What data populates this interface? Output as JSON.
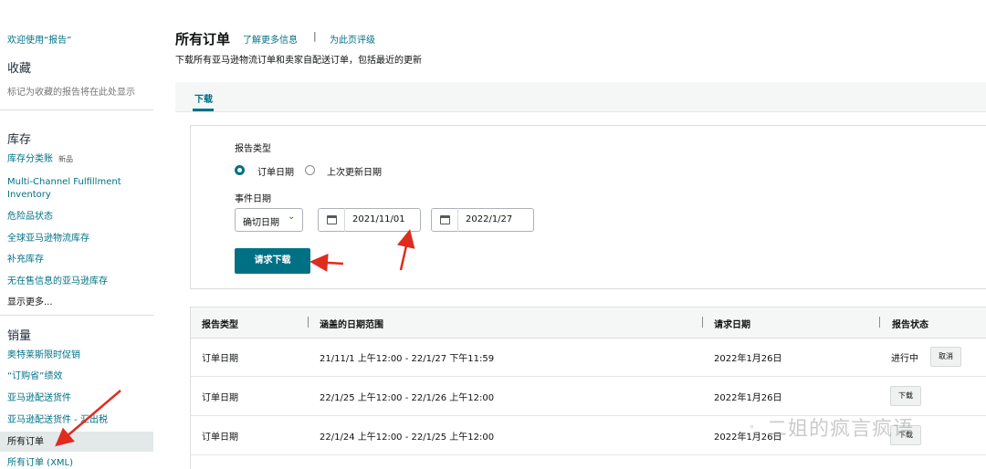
{
  "sidebar": {
    "welcome": "欢迎使用“报告”",
    "favorites_heading": "收藏",
    "favorites_note": "标记为收藏的报告将在此处显示",
    "inventory_heading": "库存",
    "inventory_items": [
      "库存分类账",
      "Multi-Channel Fulfillment Inventory",
      "危险品状态",
      "全球亚马逊物流库存",
      "补充库存",
      "无在售信息的亚马逊库存",
      "显示更多..."
    ],
    "new_badge": "新品",
    "sales_heading": "销量",
    "sales_items": [
      "奥特莱斯限时促销",
      "“订购省”绩效",
      "亚马逊配送货件",
      "亚马逊配送货件 - 汇出税",
      "所有订单",
      "所有订单 (XML)"
    ]
  },
  "header": {
    "title": "所有订单",
    "learn_more": "了解更多信息",
    "separator": "|",
    "rate_page": "为此页评级",
    "subtitle": "下载所有亚马逊物流订单和卖家自配送订单，包括最近的更新"
  },
  "tabs": {
    "download": "下载"
  },
  "form": {
    "report_type_label": "报告类型",
    "radio_order_date": "订单日期",
    "radio_last_updated": "上次更新日期",
    "event_date_label": "事件日期",
    "date_mode": "确切日期",
    "start_date": "2021/11/01",
    "end_date": "2022/1/27",
    "request_button": "请求下载"
  },
  "table": {
    "headers": [
      "报告类型",
      "涵盖的日期范围",
      "请求日期",
      "报告状态"
    ],
    "rows": [
      {
        "type": "订单日期",
        "range": "21/11/1 上午12:00 - 22/1/27 下午11:59",
        "requested": "2022年1月26日",
        "status": "进行中",
        "action": "取消"
      },
      {
        "type": "订单日期",
        "range": "22/1/25 上午12:00 - 22/1/26 上午12:00",
        "requested": "2022年1月26日",
        "status": "",
        "action": "下载"
      },
      {
        "type": "订单日期",
        "range": "22/1/24 上午12:00 - 22/1/25 上午12:00",
        "requested": "2022年1月26日",
        "status": "",
        "action": "下载"
      }
    ]
  },
  "watermark": "二姐的疯言疯语",
  "colors": {
    "link": "#007185",
    "primary_button": "#007185",
    "annotation_arrow": "#e02b1f"
  }
}
